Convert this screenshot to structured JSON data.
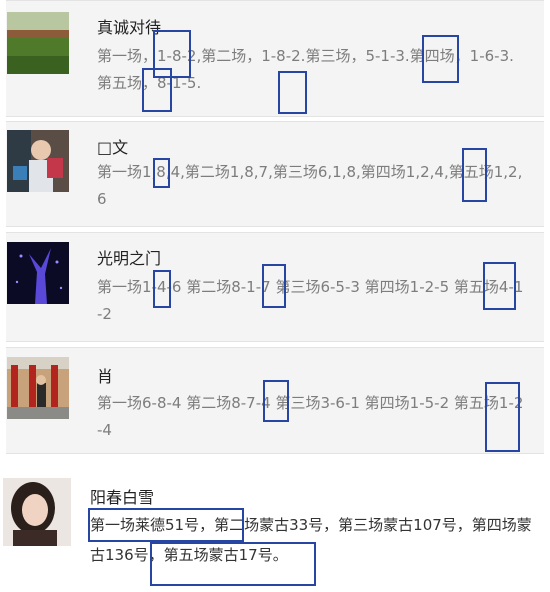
{
  "posts": [
    {
      "name": "真诚对待",
      "text": "第一场，1-8-2,第二场，1-8-2.第三场，5-1-3.第四场，1-6-3.第五场，8-1-5."
    },
    {
      "name": "□文",
      "text": "第一场1,8,4,第二场1,8,7,第三场6,1,8,第四场1,2,4,第五场1,2,6"
    },
    {
      "name": "光明之门",
      "text": "第一场1-4-6 第二场8-1-7 第三场6-5-3 第四场1-2-5 第五场4-1-2"
    },
    {
      "name": "肖",
      "text": "第一场6-8-4 第二场8-7-4 第三场3-6-1 第四场1-5-2 第五场1-2-4"
    },
    {
      "name": "阳春白雪",
      "text": "第一场莱德51号，第二场蒙古33号，第三场蒙古107号，第四场蒙古136号，第五场蒙古17号。"
    }
  ],
  "colors": {
    "highlight_box": "#2745a3",
    "panel_bg": "#f4f4f5",
    "comment_text": "#7d7d7d"
  }
}
